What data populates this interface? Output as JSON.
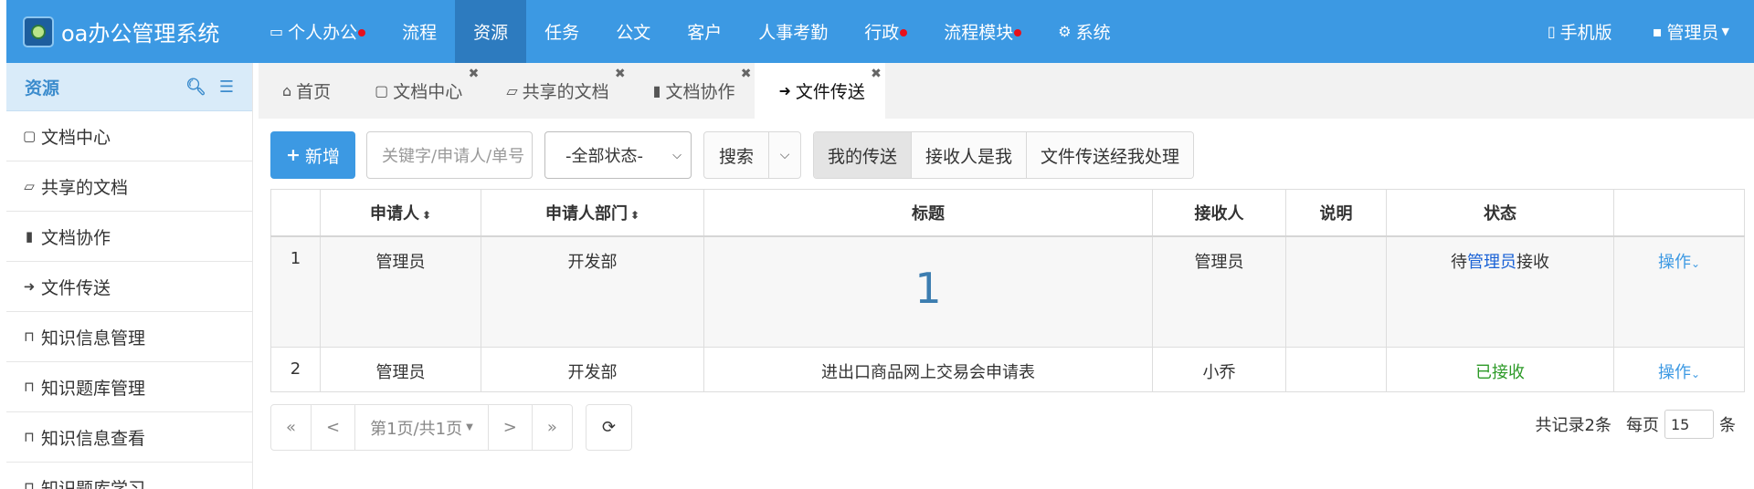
{
  "brand": {
    "title": "oa办公管理系统"
  },
  "nav": {
    "items": [
      {
        "label": "个人办公",
        "icon": "monitor-icon",
        "dot": true
      },
      {
        "label": "流程",
        "dot": false
      },
      {
        "label": "资源",
        "dot": false,
        "active": true
      },
      {
        "label": "任务",
        "dot": false
      },
      {
        "label": "公文",
        "dot": false
      },
      {
        "label": "客户",
        "dot": false
      },
      {
        "label": "人事考勤",
        "dot": false
      },
      {
        "label": "行政",
        "dot": true
      },
      {
        "label": "流程模块",
        "dot": true
      },
      {
        "label": "系统",
        "icon": "gear-icon",
        "dot": false
      }
    ],
    "mobile": "手机版",
    "user": "管理员"
  },
  "sidebar": {
    "title": "资源",
    "items": [
      {
        "label": "文档中心",
        "icon": "folder-icon"
      },
      {
        "label": "共享的文档",
        "icon": "folder-open-icon"
      },
      {
        "label": "文档协作",
        "icon": "file-icon"
      },
      {
        "label": "文件传送",
        "icon": "sign-out-icon"
      },
      {
        "label": "知识信息管理",
        "icon": "bookmark-icon"
      },
      {
        "label": "知识题库管理",
        "icon": "bookmark-icon"
      },
      {
        "label": "知识信息查看",
        "icon": "bookmark-icon"
      },
      {
        "label": "知识题库学习",
        "icon": "bookmark-icon"
      }
    ]
  },
  "tabs": [
    {
      "label": "首页",
      "icon": "home-icon",
      "closable": false
    },
    {
      "label": "文档中心",
      "icon": "folder-icon",
      "closable": true
    },
    {
      "label": "共享的文档",
      "icon": "folder-open-icon",
      "closable": true
    },
    {
      "label": "文档协作",
      "icon": "file-icon",
      "closable": true
    },
    {
      "label": "文件传送",
      "icon": "sign-out-icon",
      "closable": true,
      "active": true
    }
  ],
  "toolbar": {
    "add_label": "新增",
    "keyword_placeholder": "关键字/申请人/单号",
    "status_selected": "-全部状态-",
    "search_label": "搜索",
    "filters": [
      "我的传送",
      "接收人是我",
      "文件传送经我处理"
    ]
  },
  "table": {
    "headers": [
      "",
      "申请人",
      "申请人部门",
      "标题",
      "接收人",
      "说明",
      "状态",
      ""
    ],
    "rows": [
      {
        "index": "1",
        "applicant": "管理员",
        "dept": "开发部",
        "title": "1",
        "receiver": "管理员",
        "note": "",
        "status_prefix": "待",
        "status_link": "管理员",
        "status_suffix": "接收",
        "action": "操作"
      },
      {
        "index": "2",
        "applicant": "管理员",
        "dept": "开发部",
        "title": "进出口商品网上交易会申请表",
        "receiver": "小乔",
        "note": "",
        "status": "已接收",
        "action": "操作"
      }
    ]
  },
  "pager": {
    "first": "«",
    "prev": "<",
    "page_label": "第1页/共1页",
    "next": ">",
    "last": "»",
    "total_label": "共记录2条",
    "per_page_label": "每页",
    "per_page_value": "15",
    "unit": "条"
  },
  "colors": {
    "topbar": "#3c99e3",
    "active_nav": "#2d7bbf",
    "notify_dot": "#e8101b",
    "received": "#2c9a27"
  }
}
